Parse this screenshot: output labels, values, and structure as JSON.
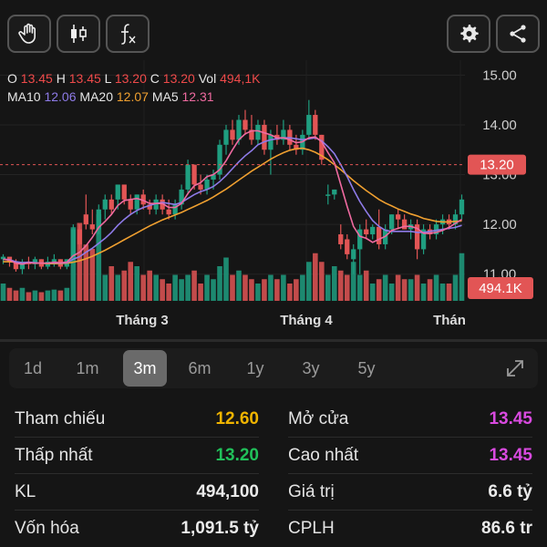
{
  "toolbar": {
    "buttons": [
      {
        "name": "hand-icon"
      },
      {
        "name": "candlestick-icon"
      },
      {
        "name": "function-icon"
      }
    ],
    "right_buttons": [
      {
        "name": "gear-icon"
      },
      {
        "name": "share-icon"
      }
    ]
  },
  "ohlc": {
    "o_label": "O",
    "o_value": "13.45",
    "h_label": "H",
    "h_value": "13.45",
    "l_label": "L",
    "l_value": "13.20",
    "c_label": "C",
    "c_value": "13.20",
    "vol_label": "Vol",
    "vol_value": "494,1K",
    "ma10_label": "MA10",
    "ma10_value": "12.06",
    "ma20_label": "MA20",
    "ma20_value": "12.07",
    "ma5_label": "MA5",
    "ma5_value": "12.31"
  },
  "chart_data": {
    "type": "candlestick",
    "y_ticks": [
      "15.00",
      "14.00",
      "13.00",
      "12.00",
      "11.00"
    ],
    "ylim": [
      10.5,
      15.3
    ],
    "x_labels": [
      "Tháng 3",
      "Tháng 4",
      "Thán"
    ],
    "price_tag": "13.20",
    "price_value": 13.2,
    "volume_tag": "494.1K",
    "colors": {
      "up": "#1f9e80",
      "down": "#e25555",
      "ma5": "#ef6aa0",
      "ma10": "#8e7be8",
      "ma20": "#f0a030"
    },
    "candles": [
      [
        11.3,
        11.4,
        11.2,
        11.35
      ],
      [
        11.35,
        11.3,
        11.15,
        11.25
      ],
      [
        11.25,
        11.3,
        11.05,
        11.1
      ],
      [
        11.1,
        11.3,
        11.0,
        11.25
      ],
      [
        11.25,
        11.35,
        11.1,
        11.2
      ],
      [
        11.2,
        11.35,
        11.1,
        11.3
      ],
      [
        11.3,
        11.3,
        11.1,
        11.15
      ],
      [
        11.15,
        11.35,
        11.1,
        11.25
      ],
      [
        11.25,
        11.4,
        11.15,
        11.3
      ],
      [
        11.3,
        11.3,
        11.1,
        11.15
      ],
      [
        11.15,
        11.3,
        11.1,
        11.3
      ],
      [
        11.3,
        12.0,
        11.3,
        11.9
      ],
      [
        11.9,
        12.0,
        11.5,
        11.6
      ],
      [
        12.2,
        12.6,
        11.9,
        12.0
      ],
      [
        12.0,
        12.3,
        11.8,
        11.9
      ],
      [
        11.9,
        12.4,
        11.8,
        12.3
      ],
      [
        12.3,
        12.6,
        12.1,
        12.5
      ],
      [
        12.5,
        12.6,
        12.2,
        12.3
      ],
      [
        12.5,
        12.8,
        12.3,
        12.8
      ],
      [
        12.8,
        12.8,
        12.4,
        12.5
      ],
      [
        12.5,
        12.6,
        12.2,
        12.3
      ],
      [
        12.3,
        12.6,
        12.2,
        12.6
      ],
      [
        12.6,
        12.7,
        12.3,
        12.4
      ],
      [
        12.4,
        12.5,
        12.2,
        12.3
      ],
      [
        12.3,
        12.6,
        12.2,
        12.5
      ],
      [
        12.5,
        12.6,
        12.2,
        12.3
      ],
      [
        12.3,
        12.5,
        12.1,
        12.2
      ],
      [
        12.2,
        12.5,
        12.1,
        12.4
      ],
      [
        12.4,
        12.8,
        12.3,
        12.7
      ],
      [
        12.7,
        13.3,
        12.6,
        13.2
      ],
      [
        13.2,
        13.2,
        12.7,
        12.8
      ],
      [
        12.8,
        13.0,
        12.6,
        12.7
      ],
      [
        12.7,
        13.0,
        12.6,
        12.9
      ],
      [
        12.9,
        13.1,
        12.7,
        13.0
      ],
      [
        13.0,
        13.7,
        12.9,
        13.6
      ],
      [
        13.6,
        14.0,
        13.4,
        13.9
      ],
      [
        13.9,
        14.1,
        13.6,
        13.7
      ],
      [
        13.7,
        14.2,
        13.6,
        14.1
      ],
      [
        14.1,
        14.3,
        13.8,
        13.9
      ],
      [
        13.9,
        14.2,
        13.6,
        13.7
      ],
      [
        13.7,
        14.1,
        13.6,
        14.0
      ],
      [
        14.0,
        14.1,
        13.4,
        13.5
      ],
      [
        13.5,
        13.9,
        13.0,
        13.8
      ],
      [
        13.8,
        14.0,
        13.6,
        13.7
      ],
      [
        13.7,
        14.1,
        13.6,
        13.9
      ],
      [
        13.9,
        14.0,
        13.5,
        13.6
      ],
      [
        13.6,
        13.8,
        13.4,
        13.5
      ],
      [
        13.5,
        13.9,
        13.4,
        13.8
      ],
      [
        13.8,
        14.5,
        13.7,
        14.2
      ],
      [
        14.2,
        14.3,
        13.7,
        13.8
      ],
      [
        13.8,
        13.8,
        13.2,
        13.3
      ],
      [
        12.6,
        12.8,
        12.4,
        12.6
      ],
      [
        12.6,
        12.7,
        12.5,
        12.7
      ],
      [
        11.8,
        12.0,
        11.5,
        11.6
      ],
      [
        11.7,
        11.8,
        11.3,
        11.4
      ],
      [
        11.3,
        11.6,
        11.0,
        11.5
      ],
      [
        11.5,
        12.0,
        11.0,
        11.9
      ],
      [
        11.9,
        12.1,
        11.7,
        11.8
      ],
      [
        11.8,
        12.0,
        11.7,
        11.95
      ],
      [
        11.95,
        12.3,
        11.5,
        11.6
      ],
      [
        11.6,
        12.0,
        11.5,
        11.9
      ],
      [
        11.9,
        12.2,
        11.8,
        12.2
      ],
      [
        12.2,
        12.3,
        11.9,
        12.1
      ],
      [
        12.1,
        12.2,
        11.9,
        11.9
      ],
      [
        11.9,
        12.1,
        11.7,
        12.0
      ],
      [
        12.0,
        12.1,
        11.3,
        11.5
      ],
      [
        11.5,
        12.0,
        11.4,
        11.9
      ],
      [
        11.9,
        12.0,
        11.7,
        11.8
      ],
      [
        11.8,
        12.1,
        11.7,
        12.0
      ],
      [
        12.0,
        12.2,
        11.8,
        12.1
      ],
      [
        12.1,
        12.2,
        11.9,
        12.0
      ],
      [
        12.0,
        12.3,
        11.9,
        12.2
      ],
      [
        12.2,
        12.6,
        12.1,
        12.5
      ]
    ],
    "volumes": [
      0.2,
      0.15,
      0.12,
      0.15,
      0.1,
      0.12,
      0.1,
      0.12,
      0.13,
      0.12,
      0.15,
      0.85,
      0.9,
      0.65,
      0.6,
      1.0,
      0.3,
      0.4,
      0.3,
      0.35,
      0.45,
      0.4,
      0.3,
      0.35,
      0.3,
      0.25,
      0.2,
      0.3,
      0.25,
      0.3,
      0.35,
      0.2,
      0.3,
      0.25,
      0.4,
      0.5,
      0.3,
      0.35,
      0.3,
      0.25,
      0.2,
      0.25,
      0.3,
      0.25,
      0.3,
      0.2,
      0.25,
      0.3,
      0.45,
      0.55,
      0.45,
      0.3,
      0.4,
      0.35,
      0.3,
      0.45,
      0.3,
      0.35,
      0.2,
      0.25,
      0.3,
      0.2,
      0.3,
      0.25,
      0.25,
      0.3,
      0.2,
      0.25,
      0.3,
      0.2,
      0.2,
      0.3,
      0.55
    ],
    "ma5": [
      11.3,
      11.28,
      11.22,
      11.2,
      11.23,
      11.22,
      11.22,
      11.22,
      11.24,
      11.23,
      11.24,
      11.37,
      11.44,
      11.57,
      11.74,
      11.94,
      12.06,
      12.2,
      12.38,
      12.48,
      12.5,
      12.52,
      12.48,
      12.42,
      12.42,
      12.42,
      12.34,
      12.34,
      12.42,
      12.62,
      12.78,
      12.84,
      12.96,
      13.0,
      13.1,
      13.28,
      13.5,
      13.7,
      13.82,
      13.88,
      13.88,
      13.84,
      13.8,
      13.74,
      13.74,
      13.7,
      13.64,
      13.66,
      13.74,
      13.76,
      13.66,
      13.44,
      13.24,
      12.8,
      12.36,
      11.96,
      11.76,
      11.72,
      11.64,
      11.7,
      11.76,
      11.88,
      11.92,
      11.96,
      11.96,
      11.92,
      11.82,
      11.82,
      11.84,
      11.88,
      11.94,
      12.02,
      12.1
    ],
    "ma10": [
      11.3,
      11.29,
      11.25,
      11.23,
      11.24,
      11.23,
      11.22,
      11.22,
      11.23,
      11.22,
      11.23,
      11.3,
      11.35,
      11.44,
      11.52,
      11.62,
      11.72,
      11.84,
      11.98,
      12.1,
      12.2,
      12.28,
      12.34,
      12.38,
      12.42,
      12.44,
      12.42,
      12.4,
      12.44,
      12.52,
      12.6,
      12.66,
      12.7,
      12.76,
      12.86,
      12.98,
      13.12,
      13.26,
      13.38,
      13.48,
      13.6,
      13.66,
      13.7,
      13.72,
      13.74,
      13.74,
      13.72,
      13.7,
      13.72,
      13.74,
      13.68,
      13.56,
      13.42,
      13.2,
      12.96,
      12.7,
      12.46,
      12.26,
      12.08,
      11.96,
      11.88,
      11.86,
      11.86,
      11.86,
      11.86,
      11.84,
      11.84,
      11.86,
      11.88,
      11.9,
      11.92,
      11.94,
      11.98
    ],
    "ma20": [
      11.25,
      11.25,
      11.24,
      11.23,
      11.23,
      11.22,
      11.22,
      11.21,
      11.21,
      11.21,
      11.22,
      11.24,
      11.27,
      11.31,
      11.36,
      11.42,
      11.48,
      11.55,
      11.62,
      11.69,
      11.76,
      11.83,
      11.9,
      11.97,
      12.03,
      12.09,
      12.14,
      12.19,
      12.24,
      12.3,
      12.36,
      12.42,
      12.48,
      12.55,
      12.63,
      12.71,
      12.8,
      12.89,
      12.98,
      13.07,
      13.15,
      13.23,
      13.31,
      13.38,
      13.44,
      13.49,
      13.52,
      13.53,
      13.5,
      13.45,
      13.38,
      13.3,
      13.2,
      13.1,
      12.99,
      12.88,
      12.78,
      12.68,
      12.59,
      12.5,
      12.43,
      12.37,
      12.31,
      12.26,
      12.21,
      12.17,
      12.12,
      12.09,
      12.06,
      12.05,
      12.05,
      12.06,
      12.07
    ]
  },
  "periods": {
    "items": [
      "1d",
      "1m",
      "3m",
      "6m",
      "1y",
      "3y",
      "5y"
    ],
    "active": "3m"
  },
  "stats": {
    "left": [
      {
        "label": "Tham chiếu",
        "value": "12.60",
        "color": "#f0b400"
      },
      {
        "label": "Thấp nhất",
        "value": "13.20",
        "color": "#21c05a"
      },
      {
        "label": "KL",
        "value": "494,100",
        "color": "#eaeaea"
      },
      {
        "label": "Vốn hóa",
        "value": "1,091.5 tỷ",
        "color": "#eaeaea"
      }
    ],
    "right": [
      {
        "label": "Mở cửa",
        "value": "13.45",
        "color": "#d94ae0"
      },
      {
        "label": "Cao nhất",
        "value": "13.45",
        "color": "#d94ae0"
      },
      {
        "label": "Giá trị",
        "value": "6.6 tỷ",
        "color": "#eaeaea"
      },
      {
        "label": "CPLH",
        "value": "86.6 tr",
        "color": "#eaeaea"
      }
    ]
  }
}
